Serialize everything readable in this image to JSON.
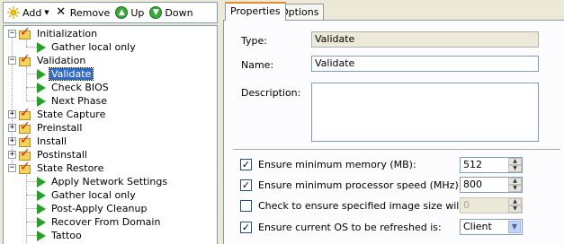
{
  "toolbar": {
    "add_label": "Add",
    "remove_label": "Remove",
    "up_label": "Up",
    "down_label": "Down"
  },
  "tree": {
    "items": [
      {
        "label": "Initialization",
        "type": "group",
        "expanded": true
      },
      {
        "label": "Gather local only",
        "type": "step"
      },
      {
        "label": "Validation",
        "type": "group",
        "expanded": true
      },
      {
        "label": "Validate",
        "type": "step",
        "selected": true
      },
      {
        "label": "Check BIOS",
        "type": "step"
      },
      {
        "label": "Next Phase",
        "type": "step"
      },
      {
        "label": "State Capture",
        "type": "group",
        "expanded": false
      },
      {
        "label": "Preinstall",
        "type": "group",
        "expanded": false
      },
      {
        "label": "Install",
        "type": "group",
        "expanded": false
      },
      {
        "label": "Postinstall",
        "type": "group",
        "expanded": false
      },
      {
        "label": "State Restore",
        "type": "group",
        "expanded": true
      },
      {
        "label": "Apply Network Settings",
        "type": "step"
      },
      {
        "label": "Gather local only",
        "type": "step"
      },
      {
        "label": "Post-Apply Cleanup",
        "type": "step"
      },
      {
        "label": "Recover From Domain",
        "type": "step"
      },
      {
        "label": "Tattoo",
        "type": "step"
      }
    ]
  },
  "tabs": [
    {
      "label": "Properties",
      "active": true
    },
    {
      "label": "Options",
      "active": false
    }
  ],
  "properties": {
    "type_label": "Type:",
    "type_value": "Validate",
    "name_label": "Name:",
    "name_value": "Validate",
    "description_label": "Description:",
    "description_value": ""
  },
  "options": [
    {
      "label": "Ensure minimum memory (MB):",
      "checked": true,
      "value": "512",
      "control": "spinner",
      "enabled": true
    },
    {
      "label": "Ensure minimum processor speed (MHz):",
      "checked": true,
      "value": "800",
      "control": "spinner",
      "enabled": true
    },
    {
      "label": "Check to ensure specified image size will fit (MB):",
      "checked": false,
      "value": "0",
      "control": "spinner",
      "enabled": false
    },
    {
      "label": "Ensure current OS to be refreshed is:",
      "checked": true,
      "value": "Client",
      "control": "dropdown",
      "enabled": true
    }
  ],
  "icons": {
    "add": "add-sun-icon",
    "remove": "remove-x-icon",
    "up": "up-arrow-icon",
    "down": "down-arrow-icon",
    "group": "folder-check-icon",
    "step": "green-play-icon"
  },
  "colors": {
    "selection": "#316ac5",
    "tab_accent": "#e68b2c",
    "step_green": "#22a322",
    "check_red": "#d81e1e"
  }
}
